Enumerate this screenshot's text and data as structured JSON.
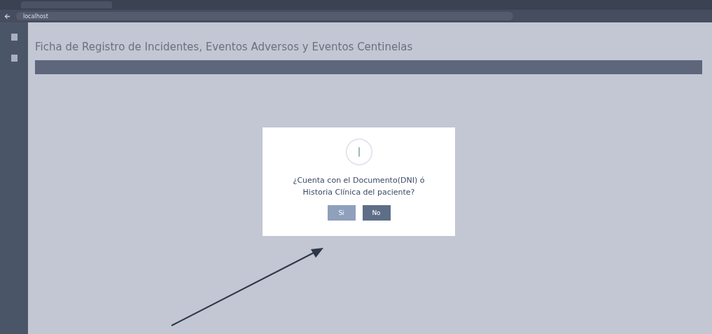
{
  "browser": {
    "address": "localhost"
  },
  "page": {
    "title": "Ficha de Registro de Incidentes, Eventos Adversos y Eventos Centinelas"
  },
  "dialog": {
    "message": "¿Cuenta con el Documento(DNI) ó Historia Clínica del paciente?",
    "buttons": [
      "Si",
      "No"
    ]
  }
}
